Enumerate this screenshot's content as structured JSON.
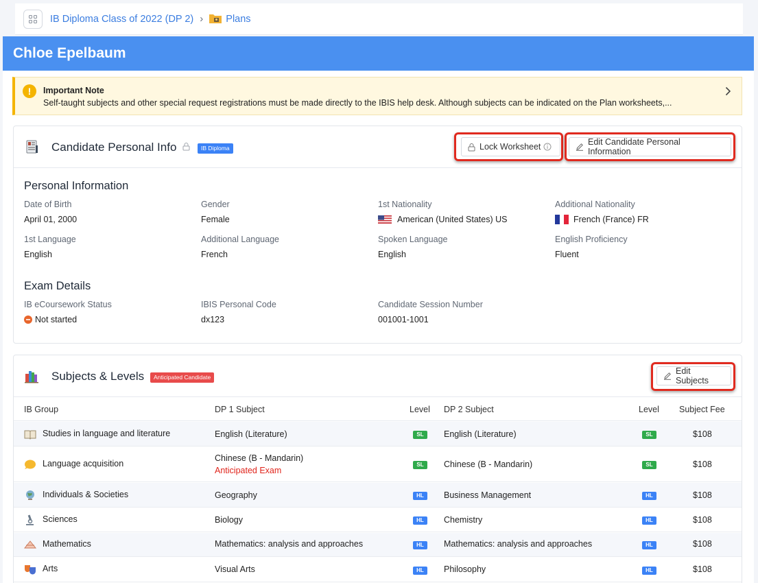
{
  "breadcrumb": {
    "parent": "IB Diploma Class of 2022 (DP 2)",
    "current": "Plans",
    "separator": "›"
  },
  "student_name": "Chloe Epelbaum",
  "note": {
    "title": "Important Note",
    "text": "Self-taught subjects and other special request registrations must be made directly to the IBIS help desk. Although subjects can be indicated on the Plan worksheets,..."
  },
  "personal": {
    "title": "Candidate Personal Info",
    "badge": "IB Diploma",
    "lock_button": "Lock Worksheet",
    "edit_button": "Edit Candidate Personal Information",
    "section_personal": "Personal Information",
    "fields": {
      "dob_label": "Date of Birth",
      "dob": "April 01, 2000",
      "gender_label": "Gender",
      "gender": "Female",
      "nat1_label": "1st Nationality",
      "nat1": "American (United States) US",
      "nat2_label": "Additional Nationality",
      "nat2": "French (France) FR",
      "lang1_label": "1st Language",
      "lang1": "English",
      "lang2_label": "Additional Language",
      "lang2": "French",
      "spoken_label": "Spoken Language",
      "spoken": "English",
      "prof_label": "English Proficiency",
      "prof": "Fluent"
    },
    "section_exam": "Exam Details",
    "exam": {
      "ecw_label": "IB eCoursework Status",
      "ecw": "Not started",
      "code_label": "IBIS Personal Code",
      "code": "dx123",
      "session_label": "Candidate Session Number",
      "session": "001001-1001"
    }
  },
  "subjects": {
    "title": "Subjects & Levels",
    "badge": "Anticipated Candidate",
    "edit_button": "Edit Subjects",
    "headers": {
      "group": "IB Group",
      "dp1": "DP 1 Subject",
      "level1": "Level",
      "dp2": "DP 2 Subject",
      "level2": "Level",
      "fee": "Subject Fee"
    },
    "rows": [
      {
        "group": "Studies in language and literature",
        "dp1": "English (Literature)",
        "dp1_note": "",
        "l1": "SL",
        "dp2": "English (Literature)",
        "l2": "SL",
        "fee": "$108"
      },
      {
        "group": "Language acquisition",
        "dp1": "Chinese (B - Mandarin)",
        "dp1_note": "Anticipated Exam",
        "l1": "SL",
        "dp2": "Chinese (B - Mandarin)",
        "l2": "SL",
        "fee": "$108"
      },
      {
        "group": "Individuals & Societies",
        "dp1": "Geography",
        "dp1_note": "",
        "l1": "HL",
        "dp2": "Business Management",
        "l2": "HL",
        "fee": "$108"
      },
      {
        "group": "Sciences",
        "dp1": "Biology",
        "dp1_note": "",
        "l1": "HL",
        "dp2": "Chemistry",
        "l2": "HL",
        "fee": "$108"
      },
      {
        "group": "Mathematics",
        "dp1": "Mathematics: analysis and approaches",
        "dp1_note": "",
        "l1": "HL",
        "dp2": "Mathematics: analysis and approaches",
        "l2": "HL",
        "fee": "$108"
      },
      {
        "group": "Arts",
        "dp1": "Visual Arts",
        "dp1_note": "",
        "l1": "HL",
        "dp2": "Philosophy",
        "l2": "HL",
        "fee": "$108"
      }
    ]
  },
  "colors": {
    "header_blue": "#4a90f0",
    "link_blue": "#3b7de0",
    "warning": "#f4b400",
    "sl_green": "#2faa4b",
    "hl_blue": "#3b82f6",
    "anticipated_red": "#e0241b",
    "highlight_red": "#e02a1f"
  }
}
